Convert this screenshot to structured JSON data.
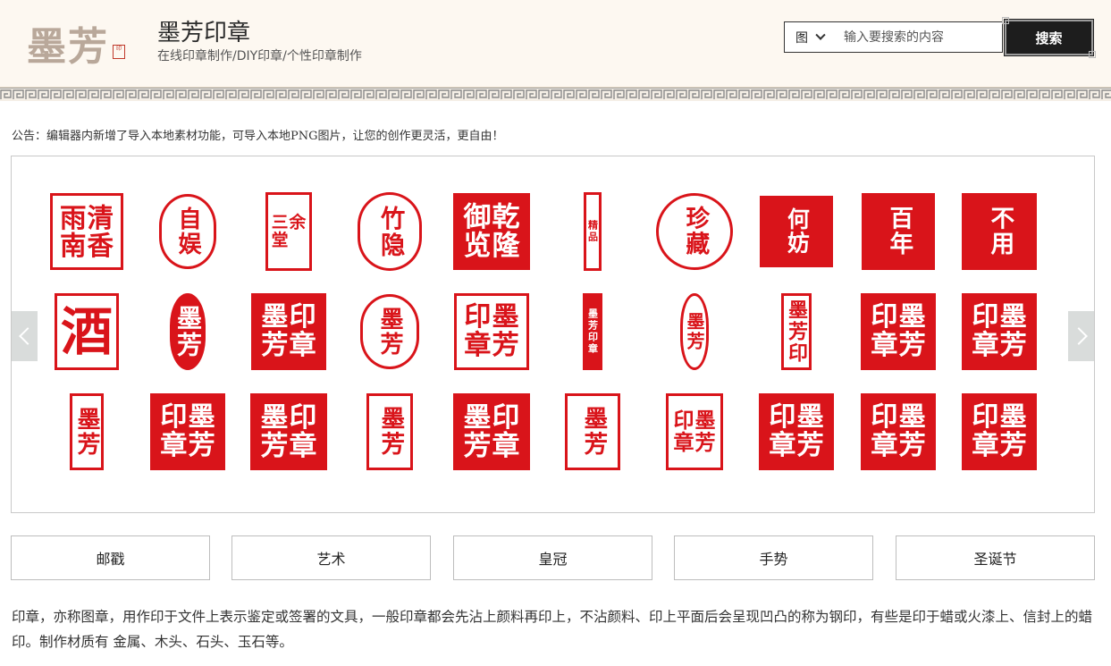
{
  "header": {
    "logo_text": "墨芳",
    "logo_stamp": "印",
    "title": "墨芳印章",
    "subtitle": "在线印章制作/DIY印章/个性印章制作"
  },
  "search": {
    "type_value": "图",
    "placeholder": "输入要搜索的内容",
    "button_label": "搜索"
  },
  "notice": "公告：编辑器内新增了导入本地素材功能，可导入本地PNG图片，让您的创作更灵活，更自由！",
  "gallery": {
    "row1": [
      "清香雨南",
      "自娱",
      "三余堂",
      "竹隐",
      "乾隆御览",
      "精品",
      "珍藏",
      "何妨",
      "百年",
      "不用"
    ],
    "row2": [
      "酒",
      "墨芳",
      "印章墨芳",
      "墨芳",
      "墨芳印章",
      "墨芳印章",
      "墨芳",
      "墨芳印",
      "墨芳印章",
      "墨芳印章"
    ],
    "row3": [
      "墨芳",
      "墨芳印章",
      "印章墨芳",
      "墨芳",
      "印章墨芳",
      "墨芳",
      "墨芳印章",
      "墨芳印章",
      "墨芳印章",
      "墨芳印章"
    ]
  },
  "categories": [
    "邮戳",
    "艺术",
    "皇冠",
    "手势",
    "圣诞节"
  ],
  "description": "印章，亦称图章，用作印于文件上表示鉴定或签署的文具，一般印章都会先沾上颜料再印上，不沾颜料、印上平面后会呈现凹凸的称为钢印，有些是印于蜡或火漆上、信封上的蜡印。制作材质有 金属、木头、石头、玉石等。",
  "colors": {
    "seal_red": "#d9141a",
    "header_bg": "#fdf8f1",
    "button_dark": "#1d1d1d"
  }
}
